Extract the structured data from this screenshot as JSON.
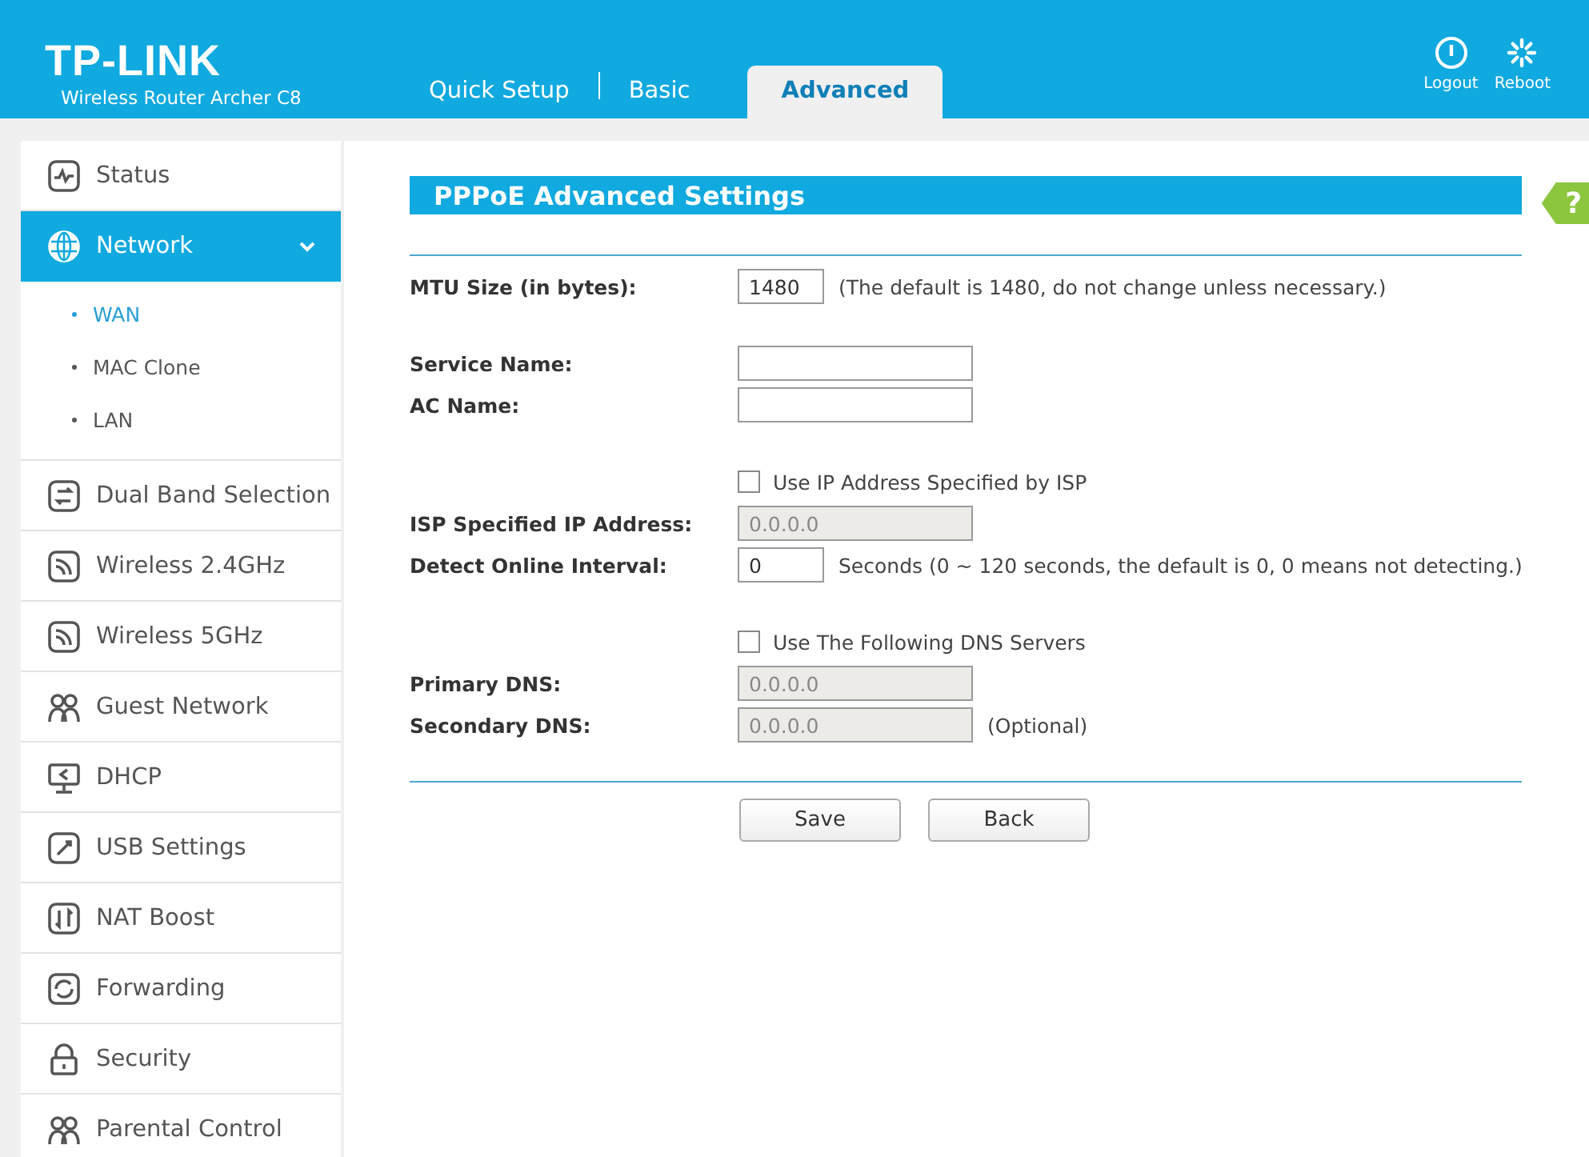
{
  "header": {
    "logo": "TP-LINK",
    "model": "Wireless Router Archer C8",
    "tabs": [
      {
        "label": "Quick Setup",
        "selected": false
      },
      {
        "label": "Basic",
        "selected": false
      },
      {
        "label": "Advanced",
        "selected": true
      }
    ],
    "actions": [
      {
        "kind": "logout",
        "label": "Logout"
      },
      {
        "kind": "reboot",
        "label": "Reboot"
      }
    ]
  },
  "sidebar": {
    "items": [
      {
        "label": "Status",
        "selected": false
      },
      {
        "label": "Network",
        "selected": true,
        "expanded": true,
        "children": [
          {
            "label": "WAN",
            "selected": true
          },
          {
            "label": "MAC Clone",
            "selected": false
          },
          {
            "label": "LAN",
            "selected": false
          }
        ]
      },
      {
        "label": "Dual Band Selection",
        "selected": false
      },
      {
        "label": "Wireless 2.4GHz",
        "selected": false
      },
      {
        "label": "Wireless 5GHz",
        "selected": false
      },
      {
        "label": "Guest Network",
        "selected": false
      },
      {
        "label": "DHCP",
        "selected": false
      },
      {
        "label": "USB Settings",
        "selected": false
      },
      {
        "label": "NAT Boost",
        "selected": false
      },
      {
        "label": "Forwarding",
        "selected": false
      },
      {
        "label": "Security",
        "selected": false
      },
      {
        "label": "Parental Control",
        "selected": false
      }
    ]
  },
  "content": {
    "title": "PPPoE Advanced Settings",
    "help": "?",
    "groups": [
      [
        {
          "kind": "number",
          "label": "MTU Size (in bytes):",
          "value": "1480",
          "disabled": false,
          "note": "(The default is 1480, do not change unless necessary.)"
        }
      ],
      [
        {
          "kind": "text",
          "label": "Service Name:",
          "disabled": false
        },
        {
          "kind": "text",
          "label": "AC Name:",
          "disabled": false
        }
      ],
      [
        {
          "kind": "checkbox",
          "label": "Use IP Address Specified by ISP",
          "checked": false
        },
        {
          "kind": "text",
          "label": "ISP Specified IP Address:",
          "value": "0.0.0.0",
          "disabled": true
        },
        {
          "kind": "number",
          "label": "Detect Online Interval:",
          "value": "0",
          "disabled": false,
          "note": "Seconds (0 ~ 120 seconds, the default is 0, 0 means not detecting.)"
        }
      ],
      [
        {
          "kind": "checkbox",
          "label": "Use The Following DNS Servers",
          "checked": false
        },
        {
          "kind": "text",
          "label": "Primary DNS:",
          "value": "0.0.0.0",
          "disabled": true
        },
        {
          "kind": "text",
          "label": "Secondary DNS:",
          "value": "0.0.0.0",
          "disabled": true,
          "note": "(Optional)"
        }
      ]
    ],
    "buttons": [
      "Save",
      "Back"
    ]
  }
}
